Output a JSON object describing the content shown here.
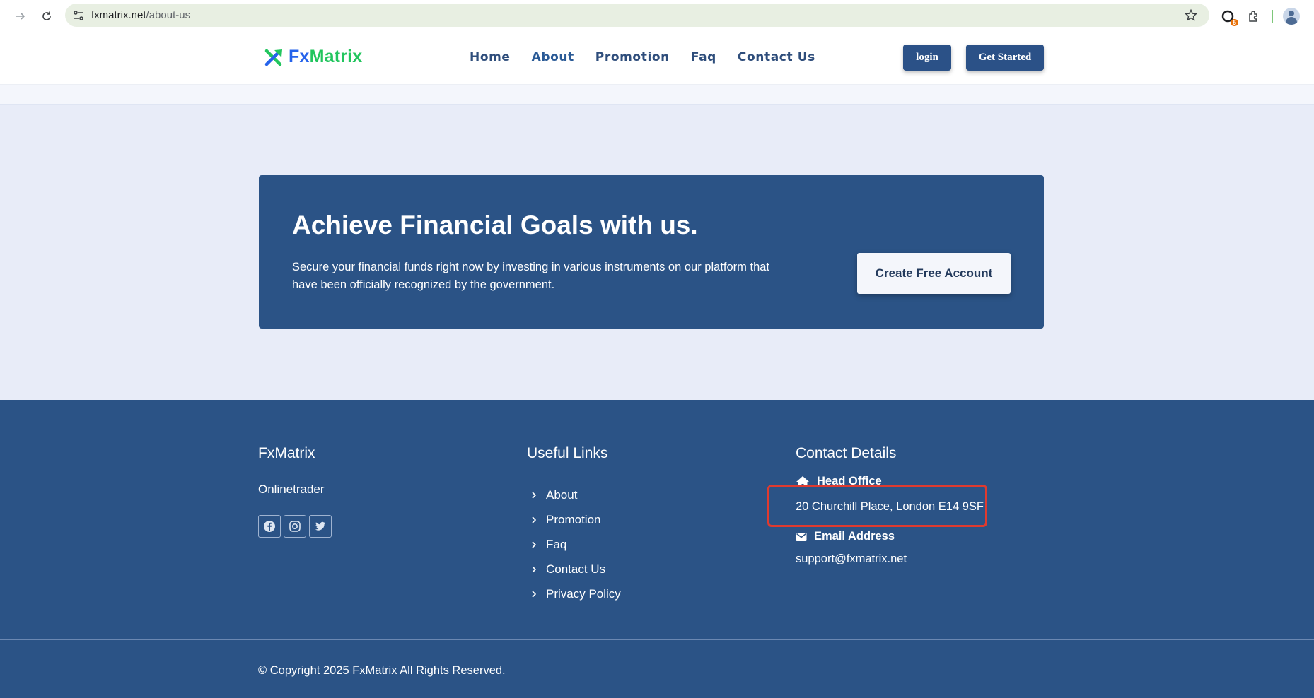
{
  "browser": {
    "url_host": "fxmatrix.net",
    "url_path": "/about-us",
    "extension_badge": "5"
  },
  "header": {
    "logo_prefix": "Fx",
    "logo_suffix": "Matrix",
    "nav": [
      "Home",
      "About",
      "Promotion",
      "Faq",
      "Contact Us"
    ],
    "login_label": "login",
    "get_started_label": "Get Started"
  },
  "cta": {
    "title": "Achieve Financial Goals with us.",
    "text": "Secure your financial funds right now by investing in various instruments on our platform that have been officially recognized by the government.",
    "button_label": "Create Free Account"
  },
  "footer": {
    "brand": {
      "title": "FxMatrix",
      "subtitle": "Onlinetrader"
    },
    "links": {
      "title": "Useful Links",
      "items": [
        "About",
        "Promotion",
        "Faq",
        "Contact Us",
        "Privacy Policy"
      ]
    },
    "contact": {
      "title": "Contact Details",
      "office_label": "Head Office",
      "office_value": "20 Churchill Place, London E14 9SF",
      "email_label": "Email Address",
      "email_value": "support@fxmatrix.net"
    },
    "copyright": "© Copyright 2025 FxMatrix All Rights Reserved."
  },
  "colors": {
    "primary": "#2b5386",
    "accent_green": "#22c55e",
    "accent_blue": "#2563eb",
    "highlight_red": "#e03a2f"
  }
}
